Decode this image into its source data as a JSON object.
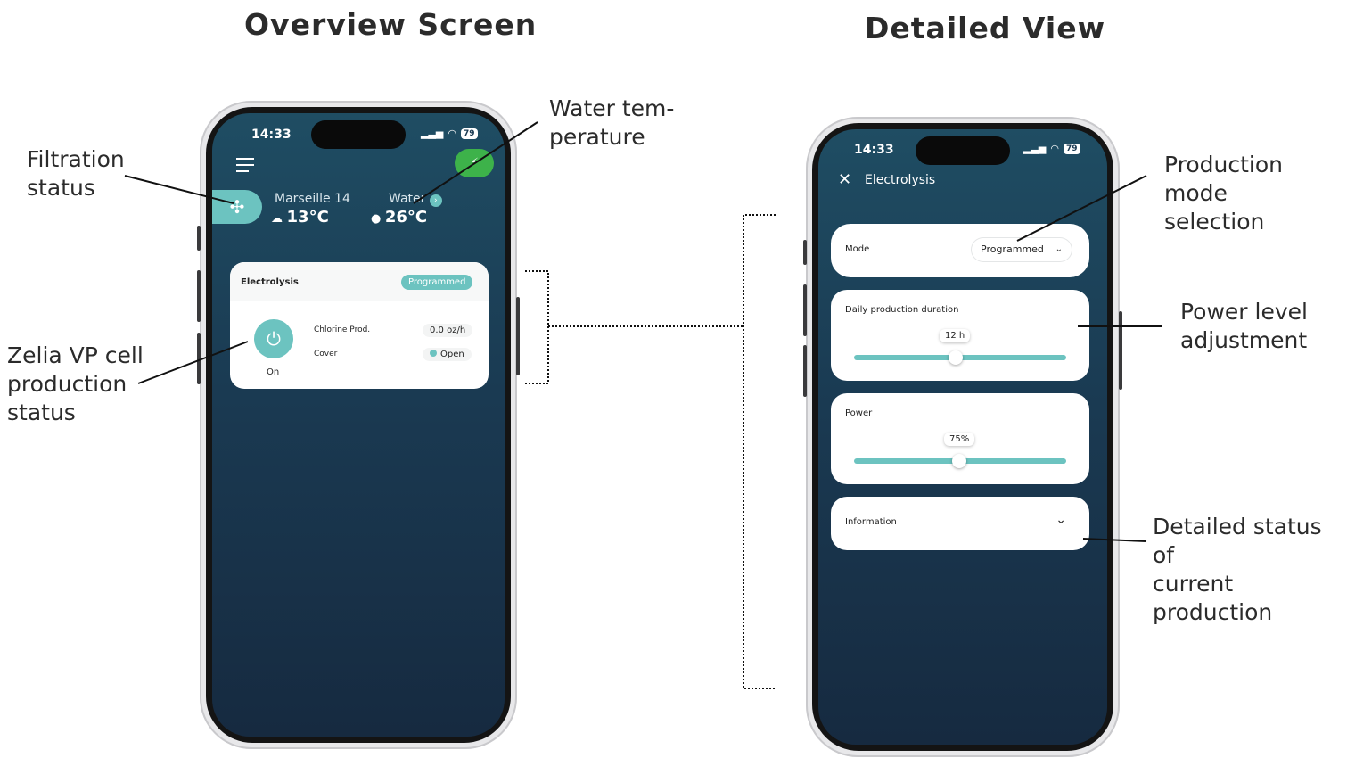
{
  "titles": {
    "overview": "Overview Screen",
    "detail": "Detailed View"
  },
  "callouts": {
    "filtration": [
      "Filtration",
      "status"
    ],
    "water_temp": [
      "Water tem-",
      "perature"
    ],
    "zelia": [
      "Zelia VP cell",
      "production",
      "status"
    ],
    "production_mode": [
      "Production mode",
      "selection"
    ],
    "power_level": [
      "Power level",
      "adjustment"
    ],
    "detailed_status": [
      "Detailed status of",
      "current production"
    ]
  },
  "overview": {
    "status_time": "14:33",
    "battery": "79",
    "city": "Marseille 14",
    "air_temp": "13°C",
    "water_label": "Water",
    "water_temp": "26°C",
    "card_title": "Electrolysis",
    "mode_badge": "Programmed",
    "power_state": "On",
    "rows": [
      {
        "label": "Chlorine Prod.",
        "value": "0.0 oz/h"
      },
      {
        "label": "Cover",
        "value": "Open"
      }
    ]
  },
  "detail": {
    "status_time": "14:33",
    "battery": "79",
    "header_title": "Electrolysis",
    "mode_label": "Mode",
    "mode_value": "Programmed",
    "duration_label": "Daily production duration",
    "duration_value": "12 h",
    "duration_fraction": 0.5,
    "power_label": "Power",
    "power_value": "75%",
    "power_fraction": 0.5,
    "info_label": "Information"
  },
  "colors": {
    "accent": "#6cc3c0",
    "green": "#3db24a",
    "screen_top": "#1f4d63",
    "screen_bottom": "#162a40"
  }
}
